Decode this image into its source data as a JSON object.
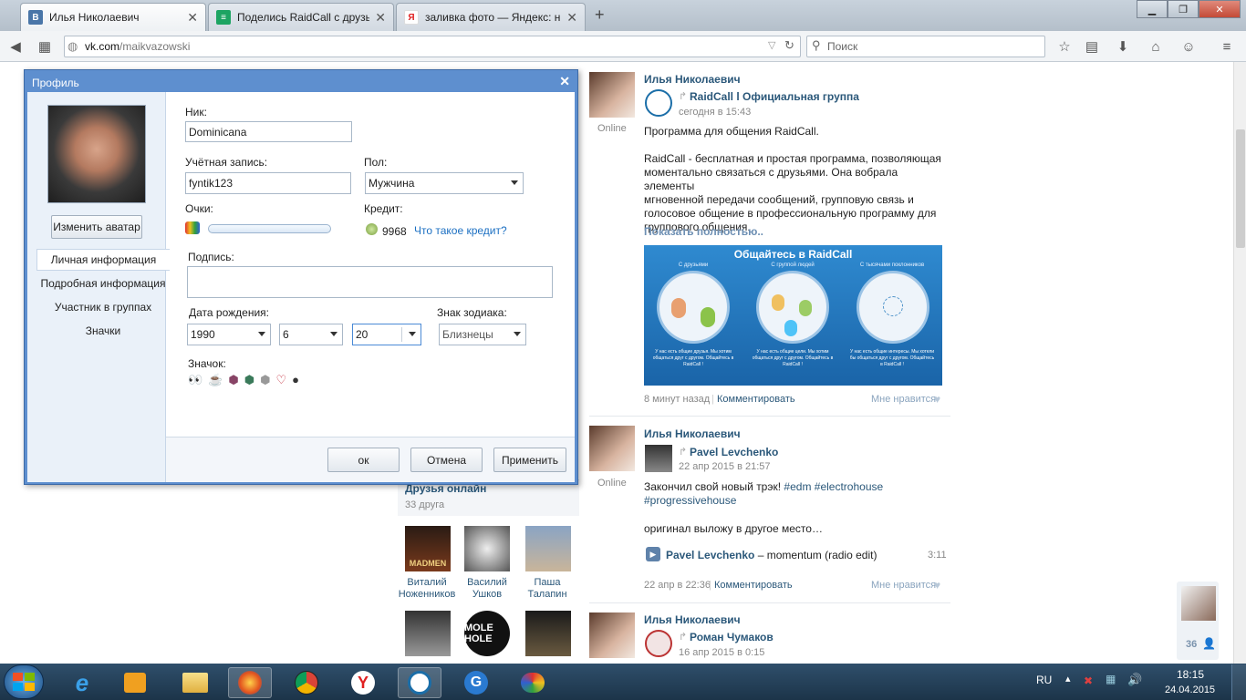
{
  "browser": {
    "tabs": [
      {
        "title": "Илья Николаевич",
        "favicon": "В",
        "color": "#4a76a8",
        "active": true
      },
      {
        "title": "Поделись RaidCall с друзья…",
        "favicon": "≡",
        "color": "#1da462",
        "active": false
      },
      {
        "title": "заливка фото — Яндекс: н…",
        "favicon": "Я",
        "color": "#e02020",
        "active": false
      }
    ],
    "url_host": "vk.com",
    "url_path": "/maikvazowski",
    "search_placeholder": "Поиск"
  },
  "feed": {
    "posts": [
      {
        "author": "Илья Николаевич",
        "status": "Online",
        "repost_from": "RaidCall l Официальная группа",
        "repost_time": "сегодня в 15:43",
        "lines": [
          "Программа для общения RaidCall.",
          "",
          "RaidCall - бесплатная и простая программа, позволяющая",
          "моментально связаться с друзьями. Она вобрала элементы",
          "мгновенной передачи сообщений, групповую связь и",
          "голосовое общение в профессиональную программу для",
          "группового общения."
        ],
        "show_more": "Показать полностью..",
        "time": "8 минут назад",
        "comment": "Комментировать",
        "like": "Мне нравится"
      },
      {
        "author": "Илья Николаевич",
        "status": "Online",
        "repost_from": "Pavel Levchenko",
        "repost_time": "22 апр 2015 в 21:57",
        "text1": "Закончил свой новый трэк!",
        "tags1": "#edm #electrohouse",
        "tags2": "#progressivehouse",
        "text2": "оригинал выложу в другое место…",
        "audio_artist": "Pavel Levchenko",
        "audio_title": " – momentum (radio edit)",
        "audio_duration": "3:11",
        "time": "22 апр в 22:36",
        "comment": "Комментировать",
        "like": "Мне нравится"
      },
      {
        "author": "Илья Николаевич",
        "repost_from": "Роман Чумаков",
        "repost_time": "16 апр 2015 в 0:15"
      }
    ],
    "banner": {
      "title": "Общайтесь в RaidCall",
      "cols": [
        {
          "head": "С друзьями",
          "foot": "У нас есть общие друзья. Мы хотим общаться друг с другом. Общайтесь в RaidCall !"
        },
        {
          "head": "С группой людей",
          "foot": "У нас есть общие цели. Мы хотим общаться друг с другом. Общайтесь в RaidCall !"
        },
        {
          "head": "С тысячами поклонников",
          "foot": "У нас есть общие интересы. Мы хотели бы общаться друг с другом. Общайтесь в RaidCall !"
        }
      ]
    }
  },
  "friends": {
    "title": "Друзья онлайн",
    "count": "33 друга",
    "items": [
      {
        "first": "Виталий",
        "last": "Ноженников",
        "thumb": "MADMEN"
      },
      {
        "first": "Василий",
        "last": "Ушков",
        "thumb": ""
      },
      {
        "first": "Паша",
        "last": "Талапин",
        "thumb": ""
      }
    ],
    "row2_thumb": "MOLE HOLE"
  },
  "side_counter": "36",
  "dialog": {
    "title": "Профиль",
    "change_avatar": "Изменить аватар",
    "nav": [
      "Личная информация",
      "Подробная информация",
      "Участник в группах",
      "Значки"
    ],
    "nick_label": "Ник:",
    "nick_value": "Dominicana",
    "account_label": "Учётная запись:",
    "account_value": "fyntik123",
    "gender_label": "Пол:",
    "gender_value": "Мужчина",
    "points_label": "Очки:",
    "credit_label": "Кредит:",
    "credit_value": "9968",
    "credit_link": "Что такое кредит?",
    "signature_label": "Подпись:",
    "birth_label": "Дата рождения:",
    "birth_year": "1990",
    "birth_month": "6",
    "birth_day": "20",
    "zodiac_label": "Знак зодиака:",
    "zodiac_value": "Близнецы",
    "badge_label": "Значок:",
    "ok": "ок",
    "cancel": "Отмена",
    "apply": "Применить"
  },
  "taskbar": {
    "lang": "RU",
    "time": "18:15",
    "date": "24.04.2015"
  }
}
